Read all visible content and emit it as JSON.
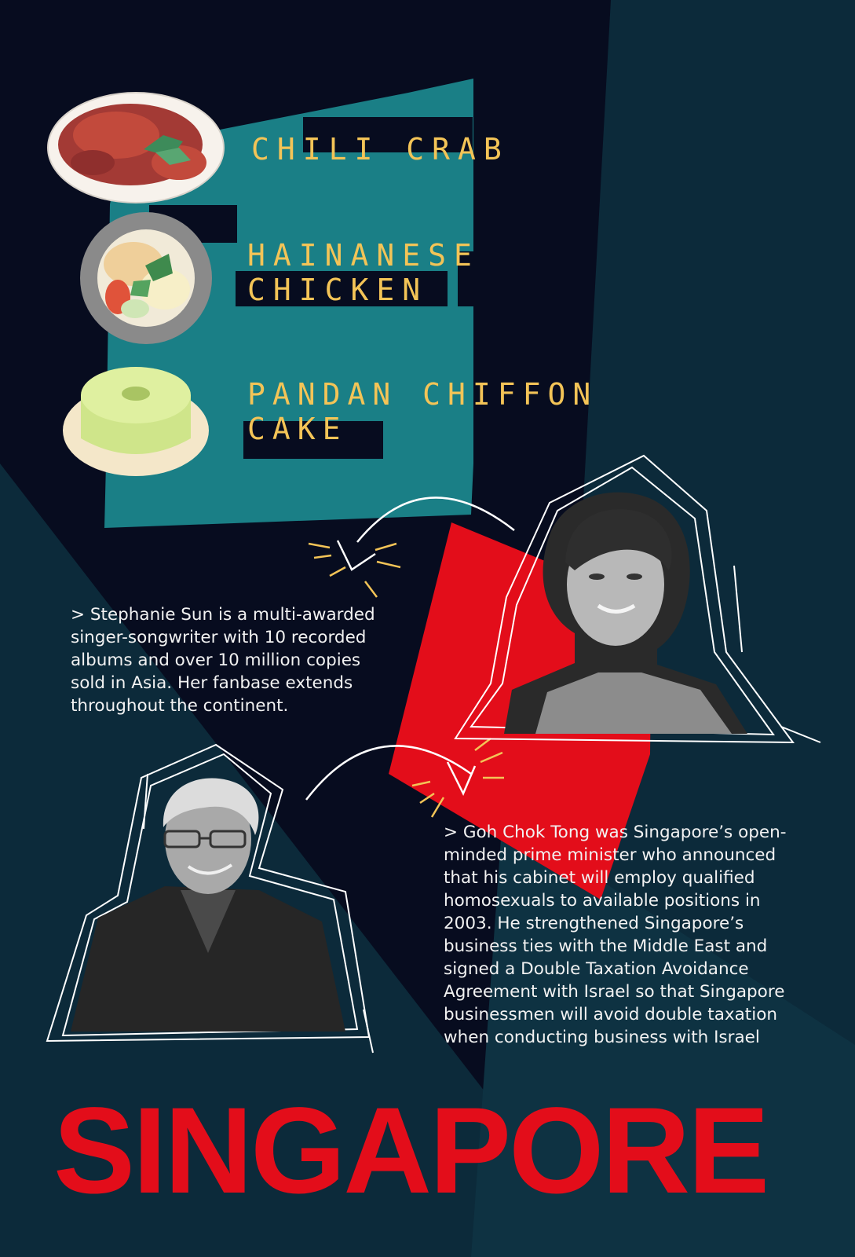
{
  "foods": [
    {
      "label": "CHILI CRAB",
      "icon": "chili-crab-plate-icon"
    },
    {
      "label": "HAINANESE\nCHICKEN",
      "icon": "hainanese-chicken-plate-icon"
    },
    {
      "label": "PANDAN CHIFFON\nCAKE",
      "icon": "pandan-chiffon-cake-icon"
    }
  ],
  "bios": [
    {
      "text": "> Stephanie Sun is a multi-awarded singer-songwriter with 10 recorded albums and over 10 million copies sold in Asia. Her fanbase extends throughout the continent."
    },
    {
      "text": "> Goh Chok Tong was Singapore’s open-minded prime minister who announced that his cabinet will employ qualified homosexuals to available positions in 2003. He strengthened Singapore’s business ties with the Middle East and signed a Double Taxation Avoidance Agreement with Israel so that Singapore businessmen will avoid double taxation when conducting business with Israel"
    }
  ],
  "title": "SINGAPORE",
  "colors": {
    "navy": "#070c1f",
    "teal_dark": "#0c2a3a",
    "teal": "#1a7f86",
    "red": "#e30d1a",
    "label_yellow": "#f3c457",
    "text": "#f2f2f2"
  }
}
